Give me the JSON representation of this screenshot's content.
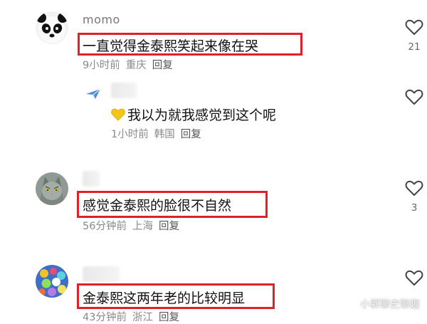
{
  "comments": [
    {
      "username": "momo",
      "text": "一直觉得金泰熙笑起来像在哭",
      "time": "9小时前",
      "location": "重庆",
      "reply": "回复",
      "likes": "21",
      "avatar": "panda-icon"
    },
    {
      "username": "",
      "badge": "paper-plane-icon",
      "text": "我以为就我感觉到这个呢",
      "emoji": "yellow-heart-icon",
      "time": "1小时前",
      "location": "韩国",
      "reply": "回复",
      "likes": ""
    },
    {
      "username": "",
      "text": "感觉金泰熙的脸很不自然",
      "time": "56分钟前",
      "location": "上海",
      "reply": "回复",
      "likes": "3",
      "avatar": "cat-icon"
    },
    {
      "username": "",
      "text": "金泰熙这两年老的比较明显",
      "time": "43分钟前",
      "location": "浙江",
      "reply": "回复",
      "likes": "",
      "avatar": "colorful-balls-icon"
    }
  ],
  "watermark": "小郭聊史聊趣",
  "colors": {
    "highlight": "#e0202a",
    "meta": "#8a8a8a",
    "emoji_heart": "#f5c518"
  }
}
